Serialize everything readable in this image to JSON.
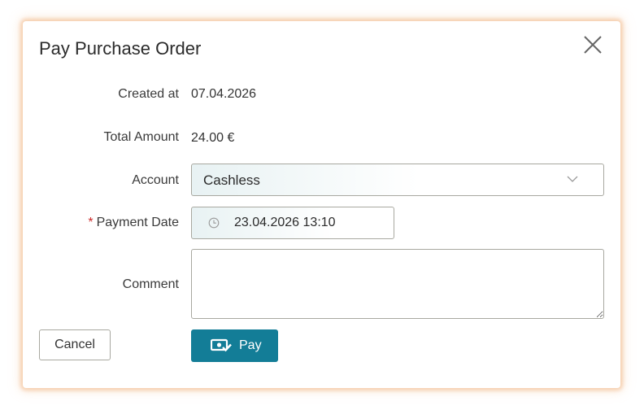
{
  "dialog": {
    "title": "Pay Purchase Order"
  },
  "form": {
    "created_at": {
      "label": "Created at",
      "value": "07.04.2026"
    },
    "total_amount": {
      "label": "Total Amount",
      "value": "24.00 €"
    },
    "account": {
      "label": "Account",
      "selected": "Cashless"
    },
    "payment_date": {
      "required_mark": "*",
      "label": "Payment Date",
      "value": "23.04.2026 13:10"
    },
    "comment": {
      "label": "Comment",
      "value": ""
    }
  },
  "actions": {
    "cancel_label": "Cancel",
    "pay_label": "Pay"
  },
  "icons": {
    "close": "close-icon",
    "dropdown": "chevron-down-icon",
    "clock": "clock-icon",
    "pay": "money-check-icon"
  },
  "colors": {
    "primary": "#137d97",
    "required": "#cc2a2a",
    "dialog_glow": "#f0b482"
  }
}
